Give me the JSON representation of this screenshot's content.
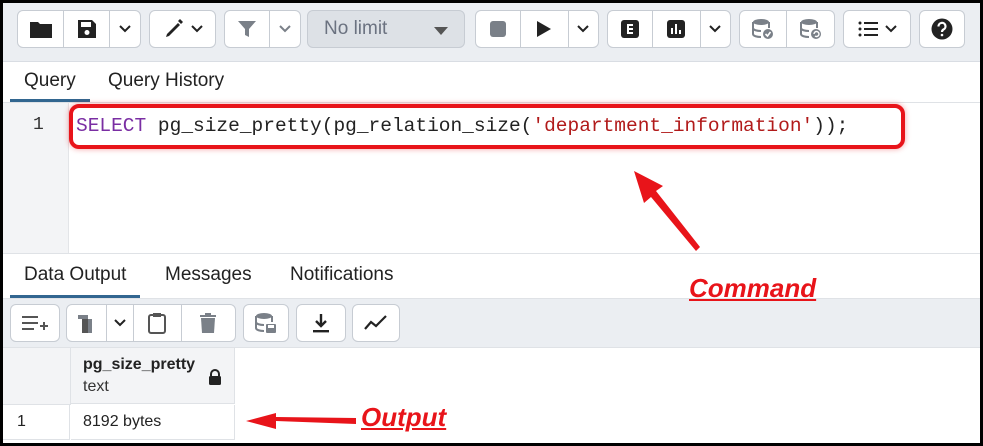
{
  "toolbar": {
    "limit_select": "No limit",
    "icons": [
      "folder-icon",
      "save-icon",
      "chevron-down-icon",
      "edit-icon",
      "filter-icon",
      "stop-icon",
      "play-icon",
      "explain-icon",
      "explain-analyze-icon",
      "commit-icon",
      "rollback-icon",
      "macros-icon",
      "help-icon"
    ]
  },
  "query_tabs": [
    {
      "label": "Query",
      "active": true
    },
    {
      "label": "Query History",
      "active": false
    }
  ],
  "editor": {
    "line_number": "1",
    "keyword": "SELECT",
    "code_mid": " pg_size_pretty(pg_relation_size(",
    "string_literal": "'department_information'",
    "code_end": "));"
  },
  "output_tabs": [
    {
      "label": "Data Output",
      "active": true
    },
    {
      "label": "Messages",
      "active": false
    },
    {
      "label": "Notifications",
      "active": false
    }
  ],
  "grid": {
    "columns": [
      {
        "name": "pg_size_pretty",
        "type": "text"
      }
    ],
    "rows": [
      {
        "row_num": "1",
        "values": [
          "8192 bytes"
        ]
      }
    ]
  },
  "annotations": {
    "command": "Command",
    "output": "Output"
  },
  "colors": {
    "highlight": "#e8141a",
    "keyword": "#7a2ea3",
    "string": "#b11a1a",
    "active_tab": "#326690"
  }
}
